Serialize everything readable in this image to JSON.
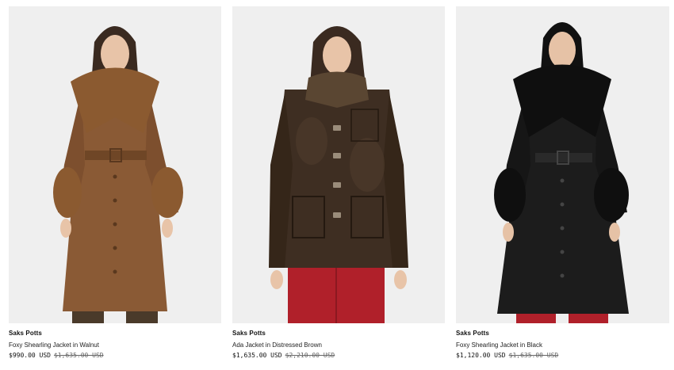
{
  "products": [
    {
      "brand": "Saks Potts",
      "name": "Foxy Shearling Jacket in Walnut",
      "sale_price": "$990.00 USD",
      "original_price": "$1,635.00 USD",
      "image_alt": "model wearing brown leather coat with shearling collar",
      "colors": {
        "coat": "#8a5a35",
        "fur": "#8b5a30",
        "pants": "#4a3a2a",
        "hair": "#3a2a20"
      }
    },
    {
      "brand": "Saks Potts",
      "name": "Ada Jacket in Distressed Brown",
      "sale_price": "$1,635.00 USD",
      "original_price": "$2,210.00 USD",
      "image_alt": "model wearing distressed brown leather jacket with red trousers",
      "colors": {
        "coat": "#3e2e22",
        "fur": "#5a4632",
        "pants": "#b0202a",
        "hair": "#3a2a20"
      }
    },
    {
      "brand": "Saks Potts",
      "name": "Foxy Shearling Jacket in Black",
      "sale_price": "$1,120.00 USD",
      "original_price": "$1,635.00 USD",
      "image_alt": "model wearing black leather coat with black shearling collar",
      "colors": {
        "coat": "#1c1c1c",
        "fur": "#0f0f0f",
        "pants": "#b0202a",
        "hair": "#111111"
      }
    }
  ]
}
